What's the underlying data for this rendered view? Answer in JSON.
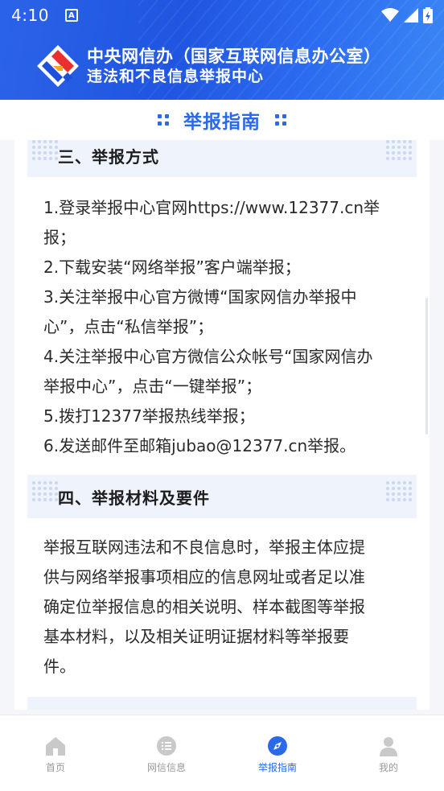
{
  "status": {
    "time": "4:10",
    "notif": "A"
  },
  "header": {
    "line1": "中央网信办（国家互联网信息办公室）",
    "line2": "违法和不良信息举报中心"
  },
  "page_title": "举报指南",
  "sections": [
    {
      "title": "三、举报方式",
      "lines": [
        "1.登录举报中心官网https://www.12377.cn举",
        "报；",
        "2.下载安装“网络举报”客户端举报；",
        "3.关注举报中心官方微博“国家网信办举报中",
        "心”，点击“私信举报”；",
        "4.关注举报中心官方微信公众帐号“国家网信办",
        "举报中心”，点击“一键举报”；",
        "5.拨打12377举报热线举报；",
        "6.发送邮件至邮箱jubao@12377.cn举报。"
      ]
    },
    {
      "title": "四、举报材料及要件",
      "lines": [
        "举报互联网违法和不良信息时，举报主体应提",
        "供与网络举报事项相应的信息网址或者足以准",
        "确定位举报信息的相关说明、样本截图等举报",
        "基本材料，以及相关证明证据材料等举报要",
        "件。"
      ]
    }
  ],
  "nav": [
    {
      "label": "首页",
      "icon": "home-icon"
    },
    {
      "label": "网信信息",
      "icon": "list-icon"
    },
    {
      "label": "举报指南",
      "icon": "compass-icon",
      "active": true
    },
    {
      "label": "我的",
      "icon": "user-icon"
    }
  ],
  "colors": {
    "accent": "#2a6ae8",
    "header": "#2563e8",
    "section_bg": "#eef3fc"
  }
}
